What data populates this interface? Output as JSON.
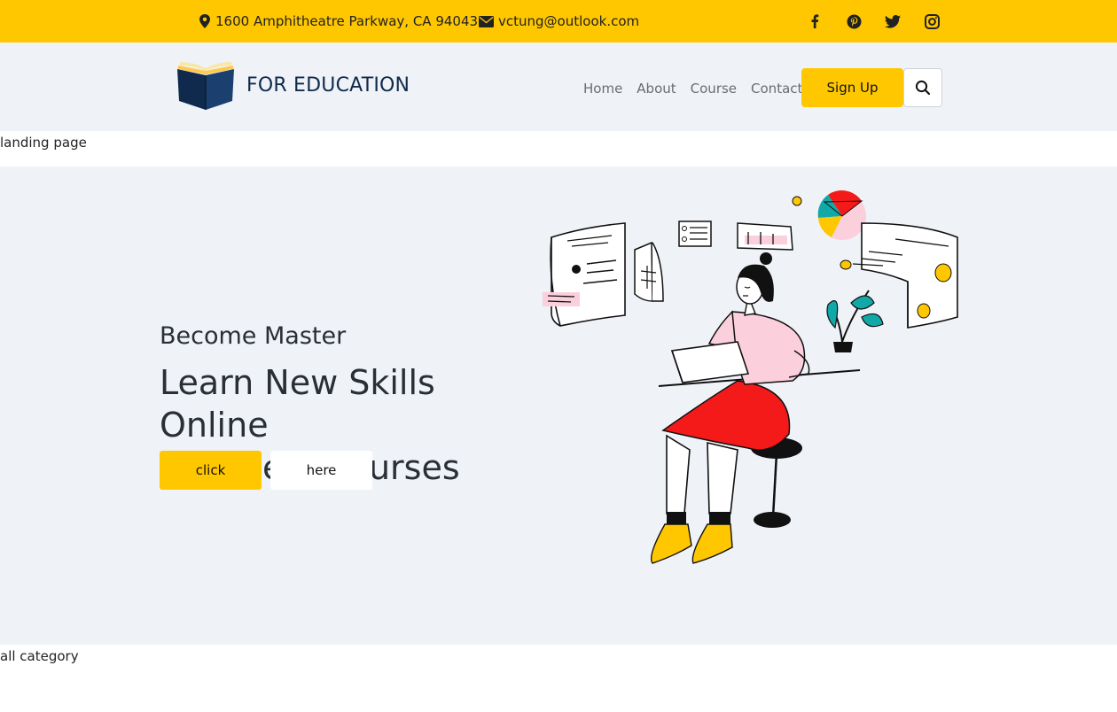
{
  "topbar": {
    "address": "1600 Amphitheatre Parkway, CA 94043",
    "email": "vctung@outlook.com",
    "socials": [
      "facebook-icon",
      "pinterest-icon",
      "twitter-icon",
      "instagram-icon"
    ],
    "background": "#ffc700"
  },
  "header": {
    "brand": "FOR EDUCATION",
    "nav": [
      "Home",
      "About",
      "Course",
      "Contact"
    ],
    "signup_label": "Sign Up",
    "search_icon": "search-icon",
    "background": "#eff2f7"
  },
  "sections": {
    "landing_label": "landing page",
    "category_label": "all category"
  },
  "hero": {
    "subtitle": "Become Master",
    "title_line1": "Learn New Skills Online",
    "title_line2": "Find Best Courses",
    "primary_button": "click",
    "secondary_button": "here"
  },
  "colors": {
    "accent": "#ffc700",
    "brand_text": "#0f2a4d",
    "illustration_red": "#f51a1a",
    "illustration_pink": "#fbcfdc",
    "illustration_teal": "#12a8a8"
  }
}
